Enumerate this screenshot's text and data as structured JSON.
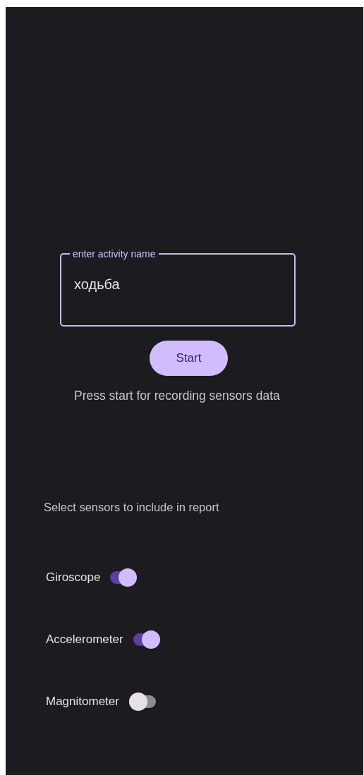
{
  "activity_field": {
    "label": "enter activity name",
    "value": "ходьба"
  },
  "start_button": {
    "label": "Start"
  },
  "hint": "Press start for recording sensors data",
  "sensors_title": "Select sensors to include in report",
  "sensors": [
    {
      "name": "Giroscope",
      "on": true
    },
    {
      "name": "Accelerometer",
      "on": true
    },
    {
      "name": "Magnitometer",
      "on": false
    }
  ]
}
